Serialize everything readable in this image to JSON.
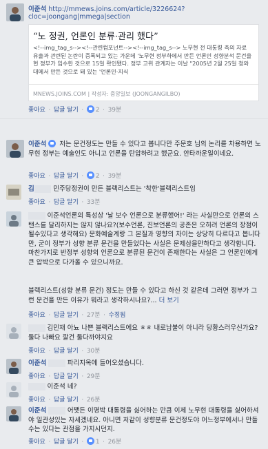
{
  "post": {
    "author": "이준석",
    "url_line1": "http://mmews.joins.com/article/3226624?",
    "url_line2": "cloc=joongang|mmega|section",
    "quote": "“노 정권, 언론인 분류·관리 했다”",
    "excerpt": "<!--img_tag_s--><!--관련컴포넌트--><!--img_tag_s--> 노무현 전 대통령 측의 자료 유출과 관련된 논란이 증폭되고 있는 가운데 '노무현 정부하에서 만든 언론인 성향분석 문건을 현 정부가 입수한 것으로 15일 확인됐다. 정부 고위 관계자는 이날 \"2005년 2월 25일 청와대에서 만든 것으로 돼 있는 '언론인·지식",
    "source_domain": "MNEWS.JOINS.COM",
    "source_author": "작성자: 중앙일보 (JOONGANGILBO)",
    "actions": {
      "like": "좋아요",
      "reply": "답글 달기",
      "count": "2",
      "time": "39분"
    }
  },
  "comments": [
    {
      "author": "이준석",
      "text": "저는 문건정도는 만들 수 있다고 봅니다만 주문호 님의 논리를 차용하면 노무현 정부는 예술인도 아니고 언론을 탄압하려고 했군요. 안타까운일이네요.",
      "actions": {
        "like": "좋아요",
        "reply": "답글 달기",
        "count": "2",
        "time": "39분"
      }
    },
    {
      "author": "김",
      "text": "민주당정권이 만든 블랙리스트는 '착한'블랙리스트임",
      "actions": {
        "like": "좋아요",
        "reply": "답글 달기",
        "time": "33분"
      }
    },
    {
      "author": "",
      "text": "이준석언론의 특성상 '날 보수 언론으로 분류했어!' 라는 사실만으로 언론의 스탠스를 달리하지는 않지 않나요?(보수언론, 진보언론의 공존은 오히려 언론의 장점이 될수있다고 생각해요) 문화예술계랑 그 본질과 영향의 차이는 상당히 다르다고 봅니다만, 굳이 정부가 성향 분류 문건을 만들었다는 사실은 문제삼을만하다고 생각합니다. 마찬가지로 반정부 성향의 언론으로 분류된 문건이 존재한다는 사실은 그 언론인에게 큰 압박으로 다가올 수 있으니까요.",
      "text2": "블랙리스트(성향 분류 문건) 정도는 만들 수 있다고 하신 것 같은데 그러면 정부가 그런 문건을 만든 이유가 뭐라고 생각하시나요?...",
      "more": "더 보기",
      "actions": {
        "like": "좋아요",
        "reply": "답글 달기",
        "time": "27분",
        "edited": "수정됨"
      }
    },
    {
      "author": "",
      "text": "김민재 아뇨 나쁜 블랙리스트에요 ㅎㅎ 내로남불이 아니라 당황스러우신가요? 둘다 나빠요 깔건 둘다까야지요",
      "actions": {
        "like": "좋아요",
        "reply": "답글 달기",
        "time": "30분"
      }
    },
    {
      "author": "이준석",
      "text": "파리지옥에 들어오셨습니다.",
      "actions": {
        "like": "좋아요",
        "reply": "답글 달기",
        "time": "29분"
      }
    },
    {
      "author": "",
      "text": "이준석 네?",
      "actions": {
        "like": "좋아요",
        "reply": "답글 달기",
        "time": "26분"
      }
    },
    {
      "author": "이준석",
      "text": "어쨋든 이명박 대통령을 싫어하는 만큼 이제 노무현 대통령을 싫어하셔야 일관성있는 자세겠네요. 아니면 저같이 성향분류 문건정도야 어느정부에서나 만들수는 있다는 관점을 가지시던지.",
      "actions": {
        "like": "좋아요",
        "reply": "답글 달기",
        "count": "1",
        "time": "26분"
      }
    }
  ],
  "colors": {
    "link": "#365899",
    "muted": "#90949c",
    "bg": "#e9ebee"
  }
}
